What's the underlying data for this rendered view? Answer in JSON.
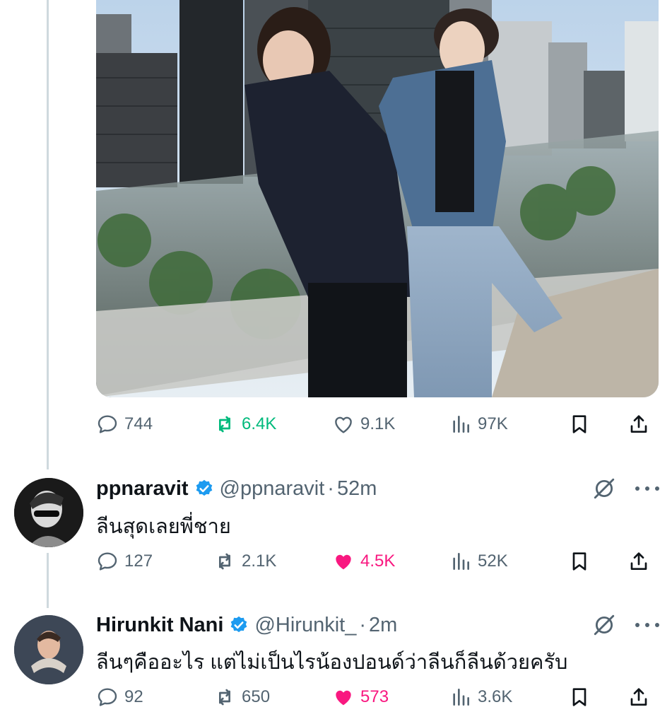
{
  "main_post": {
    "media": {
      "description": ""
    },
    "actions": {
      "replies": "744",
      "reposts": "6.4K",
      "likes": "9.1K",
      "views": "97K"
    }
  },
  "replies": [
    {
      "display_name": "ppnaravit",
      "handle": "@ppnaravit",
      "separator": "·",
      "time": "52m",
      "text": "ลีนสุดเลยพี่ชาย",
      "actions": {
        "replies": "127",
        "reposts": "2.1K",
        "likes": "4.5K",
        "views": "52K"
      },
      "liked": true
    },
    {
      "display_name": "Hirunkit Nani",
      "handle": "@Hirunkit_",
      "separator": "·",
      "time": "2m",
      "text": "ลีนๆคืออะไร แต่ไม่เป็นไรน้องปอนด์ว่าลีนก็ลีนด้วยครับ",
      "actions": {
        "replies": "92",
        "reposts": "650",
        "likes": "573",
        "views": "3.6K"
      },
      "liked": true
    }
  ],
  "colors": {
    "text": "#0f1419",
    "secondary": "#536471",
    "repost_active": "#00ba7c",
    "like_active": "#f91880",
    "verified": "#1d9bf0"
  }
}
